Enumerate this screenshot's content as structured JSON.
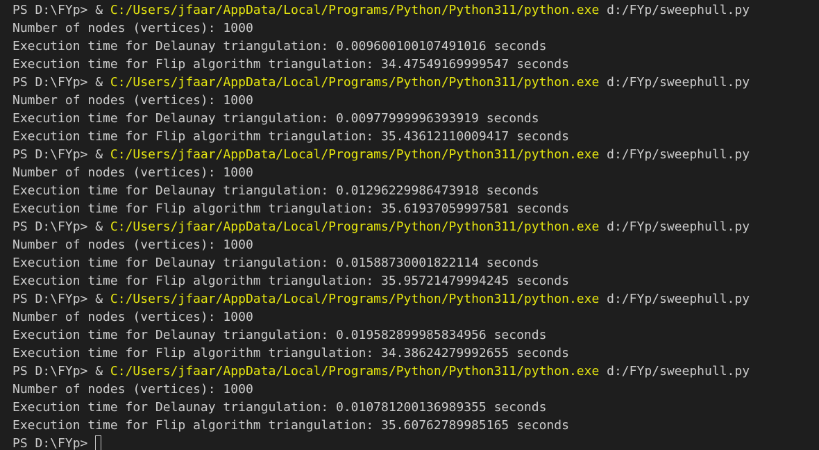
{
  "terminal": {
    "runs": [
      {
        "prompt": "PS D:\\FYp> & ",
        "exe": "C:/Users/jfaar/AppData/Local/Programs/Python/Python311/python.exe",
        "script": " d:/FYp/sweephull.py",
        "nodes": "Number of nodes (vertices): 1000",
        "delaunay": "Execution time for Delaunay triangulation: 0.009600100107491016 seconds",
        "flip": "Execution time for Flip algorithm triangulation: 34.47549169999547 seconds"
      },
      {
        "prompt": "PS D:\\FYp> & ",
        "exe": "C:/Users/jfaar/AppData/Local/Programs/Python/Python311/python.exe",
        "script": " d:/FYp/sweephull.py",
        "nodes": "Number of nodes (vertices): 1000",
        "delaunay": "Execution time for Delaunay triangulation: 0.00977999996393919 seconds",
        "flip": "Execution time for Flip algorithm triangulation: 35.43612110009417 seconds"
      },
      {
        "prompt": "PS D:\\FYp> & ",
        "exe": "C:/Users/jfaar/AppData/Local/Programs/Python/Python311/python.exe",
        "script": " d:/FYp/sweephull.py",
        "nodes": "Number of nodes (vertices): 1000",
        "delaunay": "Execution time for Delaunay triangulation: 0.01296229986473918 seconds",
        "flip": "Execution time for Flip algorithm triangulation: 35.61937059997581 seconds"
      },
      {
        "prompt": "PS D:\\FYp> & ",
        "exe": "C:/Users/jfaar/AppData/Local/Programs/Python/Python311/python.exe",
        "script": " d:/FYp/sweephull.py",
        "nodes": "Number of nodes (vertices): 1000",
        "delaunay": "Execution time for Delaunay triangulation: 0.01588730001822114 seconds",
        "flip": "Execution time for Flip algorithm triangulation: 35.95721479994245 seconds"
      },
      {
        "prompt": "PS D:\\FYp> & ",
        "exe": "C:/Users/jfaar/AppData/Local/Programs/Python/Python311/python.exe",
        "script": " d:/FYp/sweephull.py",
        "nodes": "Number of nodes (vertices): 1000",
        "delaunay": "Execution time for Delaunay triangulation: 0.019582899985834956 seconds",
        "flip": "Execution time for Flip algorithm triangulation: 34.38624279992655 seconds"
      },
      {
        "prompt": "PS D:\\FYp> & ",
        "exe": "C:/Users/jfaar/AppData/Local/Programs/Python/Python311/python.exe",
        "script": " d:/FYp/sweephull.py",
        "nodes": "Number of nodes (vertices): 1000",
        "delaunay": "Execution time for Delaunay triangulation: 0.010781200136989355 seconds",
        "flip": "Execution time for Flip algorithm triangulation: 35.60762789985165 seconds"
      }
    ],
    "final_prompt": "PS D:\\FYp> ",
    "colors": {
      "background": "#1e1e1e",
      "text": "#cccccc",
      "path": "#e5e510"
    }
  }
}
